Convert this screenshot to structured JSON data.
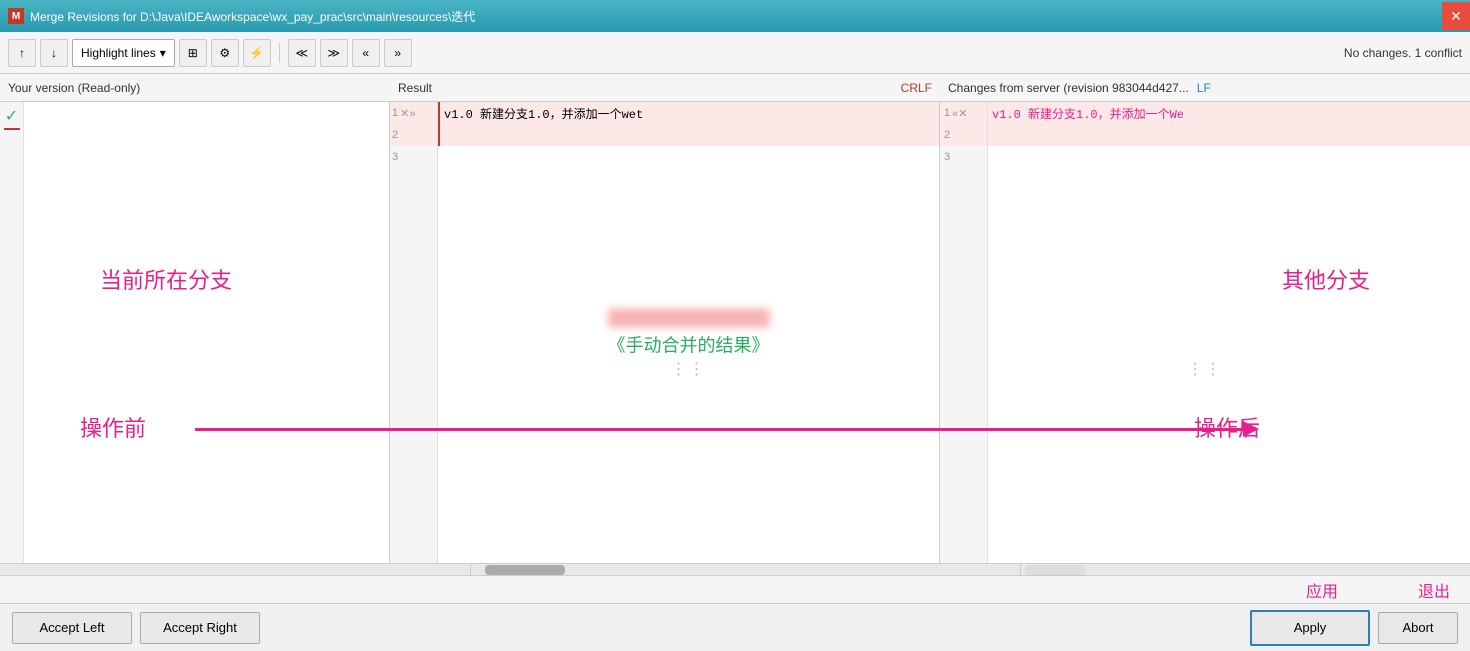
{
  "titlebar": {
    "icon_label": "M",
    "title": "Merge Revisions for D:\\Java\\IDEAworkspace\\wx_pay_prac\\src\\main\\resources\\迭代",
    "close_label": "✕"
  },
  "toolbar": {
    "up_label": "↑",
    "down_label": "↓",
    "highlight_label": "Highlight lines",
    "dropdown_arrow": "▾",
    "panels_icon": "⊞",
    "settings_icon": "⚙",
    "magic_icon": "⚡",
    "prev_conflict_icon": "≪",
    "next_conflict_icon": "≫",
    "prev_change_icon": "«",
    "next_change_icon": "»",
    "status": "No changes. 1 conflict"
  },
  "columns": {
    "left_header": "Your version (Read-only)",
    "middle_header": "Result",
    "crlf_label": "CRLF",
    "right_header": "Changes from server (revision 983044d427...",
    "lf_label": "LF"
  },
  "left_panel": {
    "label": "当前所在分支"
  },
  "middle_panel": {
    "lines": [
      {
        "num": 1,
        "content": "v1.0  新建分支1.0，并添加一个wet"
      },
      {
        "num": 2,
        "content": ""
      },
      {
        "num": 3,
        "content": ""
      }
    ],
    "blurred_text": "████████ ██",
    "merge_result_label": "《手动合并的结果》"
  },
  "right_panel": {
    "lines": [
      {
        "num": 1,
        "content": "v1.0  新建分支1.0，并添加一个We"
      },
      {
        "num": 2,
        "content": ""
      },
      {
        "num": 3,
        "content": ""
      }
    ],
    "label": "其他分支"
  },
  "annotations": {
    "before_label": "操作前",
    "after_label": "操作后",
    "apply_label": "应用",
    "abort_label": "退出"
  },
  "footer": {
    "accept_left_label": "Accept Left",
    "accept_right_label": "Accept Right",
    "apply_label": "Apply",
    "abort_label": "Abort"
  }
}
